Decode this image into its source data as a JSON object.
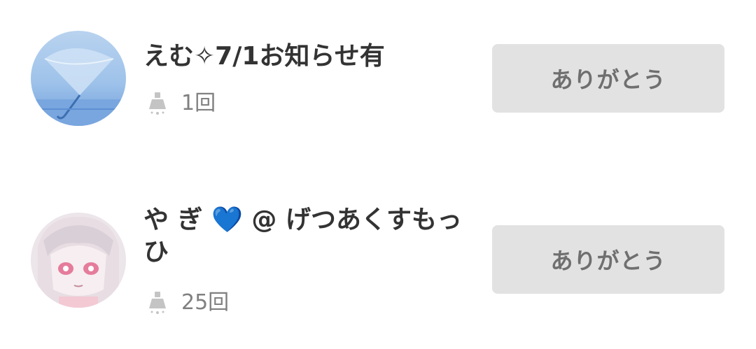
{
  "users": [
    {
      "name": "えむ✧7/1お知らせ有",
      "count": "1回",
      "button_label": "ありがとう",
      "avatar": "umbrella-avatar"
    },
    {
      "name": "や ぎ 💙 @ げつあくすもっ ひ",
      "count": "25回",
      "button_label": "ありがとう",
      "avatar": "anime-girl-avatar"
    }
  ],
  "colors": {
    "button_bg": "#e2e2e2",
    "button_text": "#6f6f6f",
    "name_text": "#333333",
    "count_text": "#808080",
    "heart": "#1a73d9"
  }
}
